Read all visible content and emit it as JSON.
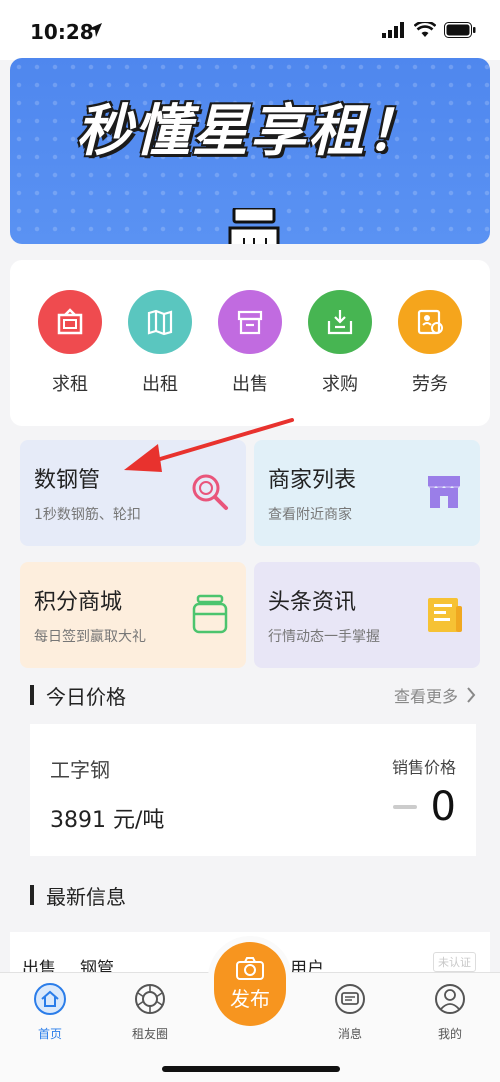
{
  "status_bar": {
    "time": "10:28"
  },
  "banner": {
    "title": "秒懂星享租！"
  },
  "quick_actions": [
    {
      "label": "求租",
      "color": "#ef4b4f",
      "icon": "frame-icon"
    },
    {
      "label": "出租",
      "color": "#5ac6bf",
      "icon": "map-icon"
    },
    {
      "label": "出售",
      "color": "#c16be0",
      "icon": "box-icon"
    },
    {
      "label": "求购",
      "color": "#47b552",
      "icon": "download-box-icon"
    },
    {
      "label": "劳务",
      "color": "#f5a51c",
      "icon": "id-card-icon"
    }
  ],
  "tiles": [
    {
      "title": "数钢管",
      "subtitle": "1秒数钢筋、轮扣",
      "bg": "#e6ebf8",
      "icon": "magnifier-icon"
    },
    {
      "title": "商家列表",
      "subtitle": "查看附近商家",
      "bg": "#e1f0f8",
      "icon": "store-icon"
    },
    {
      "title": "积分商城",
      "subtitle": "每日签到赢取大礼",
      "bg": "#fdeedd",
      "icon": "jar-icon"
    },
    {
      "title": "头条资讯",
      "subtitle": "行情动态一手掌握",
      "bg": "#e8e6f6",
      "icon": "newspaper-icon"
    }
  ],
  "today_price": {
    "section_title": "今日价格",
    "more": "查看更多",
    "item_name": "工字钢",
    "item_price": "3891 元/吨",
    "sale_label": "销售价格",
    "change": "0"
  },
  "latest_info": {
    "section_title": "最新信息",
    "peek_type": "出售",
    "peek_product": "钢管",
    "peek_user": "用户",
    "badge": "未认证"
  },
  "tabbar": {
    "items": [
      {
        "label": "首页",
        "active": true
      },
      {
        "label": "租友圈",
        "active": false
      },
      {
        "label": "消息",
        "active": false
      },
      {
        "label": "我的",
        "active": false
      }
    ],
    "publish": "发布"
  }
}
